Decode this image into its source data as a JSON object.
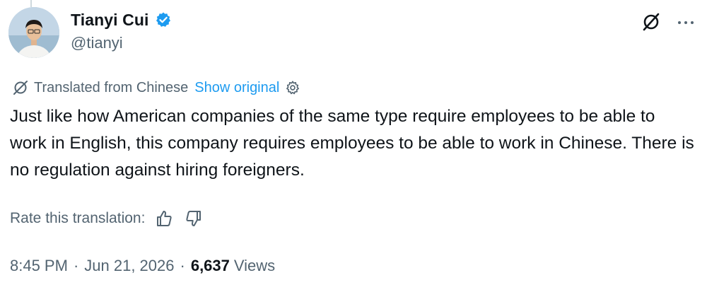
{
  "author": {
    "display_name": "Tianyi Cui",
    "handle": "@tianyi",
    "verified": true,
    "verified_color": "#1d9bf0"
  },
  "icons": {
    "top_right": [
      "grok-icon",
      "more-icon"
    ],
    "translation": "translate-icon",
    "settings": "gear-icon",
    "rate_up": "thumbs-up-icon",
    "rate_down": "thumbs-down-icon"
  },
  "translation": {
    "label": "Translated from Chinese",
    "show_original": "Show original",
    "link_color": "#1d9bf0"
  },
  "tweet": {
    "text": "Just like how American companies of the same type require employees to be able to work in English, this company requires employees to be able to work in Chinese. There is no regulation against hiring foreigners."
  },
  "rating": {
    "label": "Rate this translation:"
  },
  "meta": {
    "time": "8:45 PM",
    "date": "Jun 21, 2026",
    "views_count": "6,637",
    "views_label": "Views"
  }
}
